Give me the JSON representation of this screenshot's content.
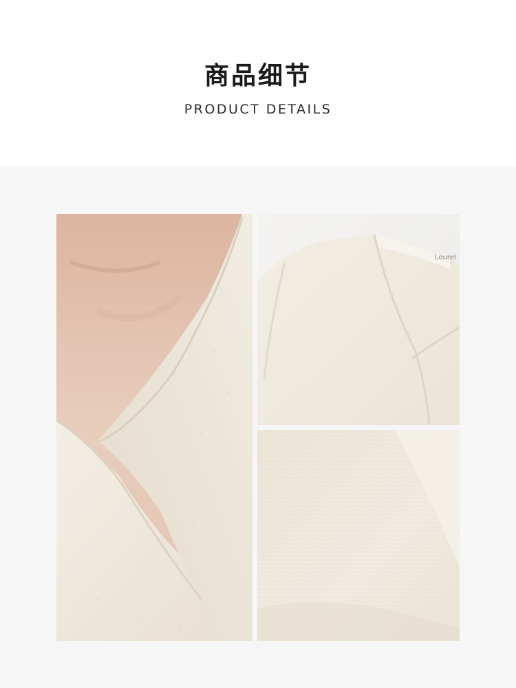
{
  "header": {
    "title_cn": "商品细节",
    "title_en": "PRODUCT DETAILS"
  },
  "gallery": {
    "photos": [
      {
        "subject": "close-up of V-neck wrap knit cardigan worn on model"
      },
      {
        "subject": "flat view of cream knit cardigan neckline with brand label"
      },
      {
        "subject": "macro close-up of cream knit fabric texture"
      }
    ],
    "label_text": "Lourel"
  },
  "colors": {
    "page_bg": "#ffffff",
    "gallery_bg": "#f6f6f6",
    "knit_cream": "#efe9dd",
    "skin": "#e6c8b4"
  }
}
